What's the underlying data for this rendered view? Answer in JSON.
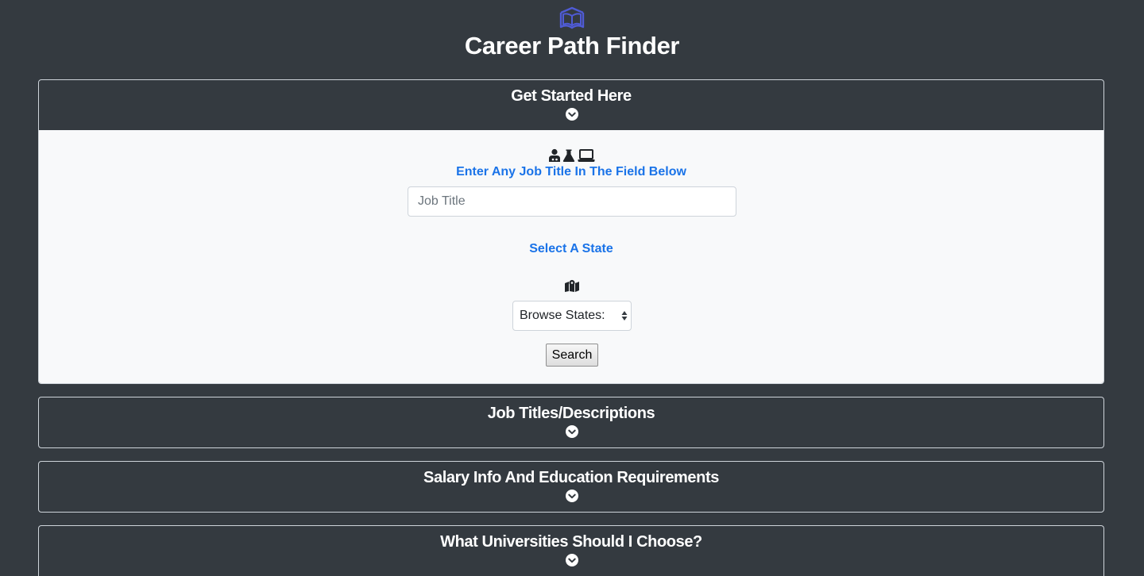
{
  "app": {
    "title": "Career Path Finder",
    "logo_icon": "open-book-icon",
    "accent_color": "#4f5bd5"
  },
  "sections": [
    {
      "title": "Get Started Here",
      "expanded": true
    },
    {
      "title": "Job Titles/Descriptions",
      "expanded": false
    },
    {
      "title": "Salary Info And Education Requirements",
      "expanded": false
    },
    {
      "title": "What Universities Should I Choose?",
      "expanded": false
    }
  ],
  "form": {
    "icons": [
      "user-doctor-icon",
      "flask-icon",
      "laptop-icon"
    ],
    "job_label": "Enter Any Job Title In The Field Below",
    "job_placeholder": "Job Title",
    "job_value": "",
    "state_label": "Select A State",
    "state_icon": "map-icon",
    "state_select_value": "Browse States:",
    "search_label": "Search"
  },
  "colors": {
    "background": "#343a40",
    "panel": "#f8f9fa",
    "label_blue": "#1a73e8"
  }
}
